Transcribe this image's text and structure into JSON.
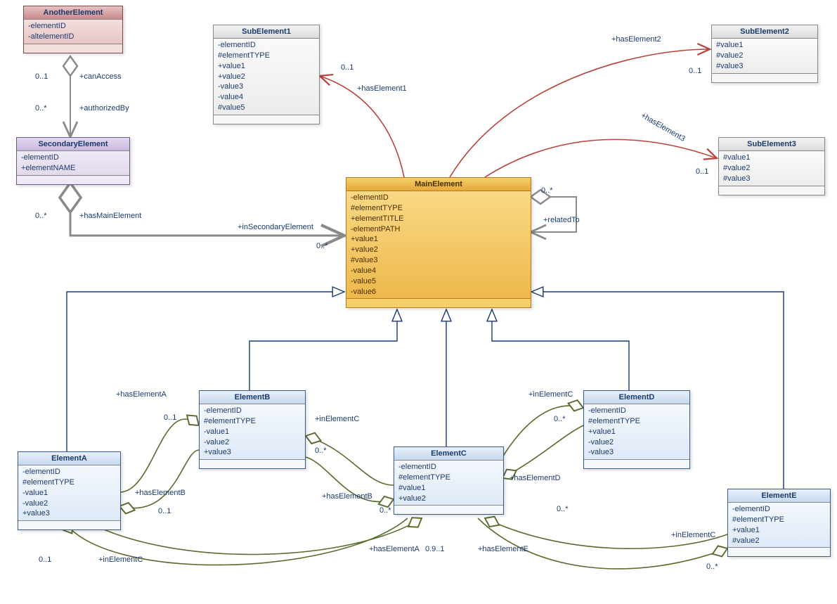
{
  "classes": {
    "another": {
      "title": "AnotherElement",
      "attrs": [
        "-elementID",
        "-altelementID"
      ]
    },
    "secondary": {
      "title": "SecondaryElement",
      "attrs": [
        "-elementID",
        "+elementNAME"
      ]
    },
    "sub1": {
      "title": "SubElement1",
      "attrs": [
        "-elementID",
        "#elementTYPE",
        "+value1",
        "+value2",
        "-value3",
        "-value4",
        "#value5"
      ]
    },
    "sub2": {
      "title": "SubElement2",
      "attrs": [
        "#value1",
        "#value2",
        "#value3"
      ]
    },
    "sub3": {
      "title": "SubElement3",
      "attrs": [
        "#value1",
        "#value2",
        "#value3"
      ]
    },
    "main": {
      "title": "MainElement",
      "attrs": [
        "-elementID",
        "#elementTYPE",
        "+elementTITLE",
        "-elementPATH",
        "+value1",
        "+value2",
        "#value3",
        "-value4",
        "-value5",
        "-value6"
      ]
    },
    "elA": {
      "title": "ElementA",
      "attrs": [
        "-elementID",
        "#elementTYPE",
        "-value1",
        "-value2",
        "+value3"
      ]
    },
    "elB": {
      "title": "ElementB",
      "attrs": [
        "-elementID",
        "#elementTYPE",
        "-value1",
        "-value2",
        "+value3"
      ]
    },
    "elC": {
      "title": "ElementC",
      "attrs": [
        "-elementID",
        "#elementTYPE",
        "#value1",
        "+value2"
      ]
    },
    "elD": {
      "title": "ElementD",
      "attrs": [
        "-elementID",
        "#elementTYPE",
        "+value1",
        "-value2",
        "-value3"
      ]
    },
    "elE": {
      "title": "ElementE",
      "attrs": [
        "-elementID",
        "#elementTYPE",
        "+value1",
        "#value2"
      ]
    }
  },
  "labels": {
    "canAccess": "+canAccess",
    "authorizedBy": "+authorizedBy",
    "hasMainElement": "+hasMainElement",
    "inSecondaryElement": "+inSecondaryElement",
    "hasElement1": "+hasElement1",
    "hasElement2": "+hasElement2",
    "hasElement3": "+hasElement3",
    "relatedTo": "+relatedTo",
    "hasElementA": "+hasElementA",
    "inElementC_b": "+inElementC",
    "hasElementB_ab": "+hasElementB",
    "hasElementB_cb": "+hasElementB",
    "hasElementD": "+hasElementD",
    "inElementC_d": "+inElementC",
    "hasElementE": "+hasElementE",
    "inElementC_e": "+inElementC",
    "hasElementA_ca": "+hasElementA",
    "inElementC_ca": "+inElementC"
  },
  "mult": {
    "m01": "0..1",
    "m0s": "0..*",
    "m0901": "0.9..1"
  }
}
